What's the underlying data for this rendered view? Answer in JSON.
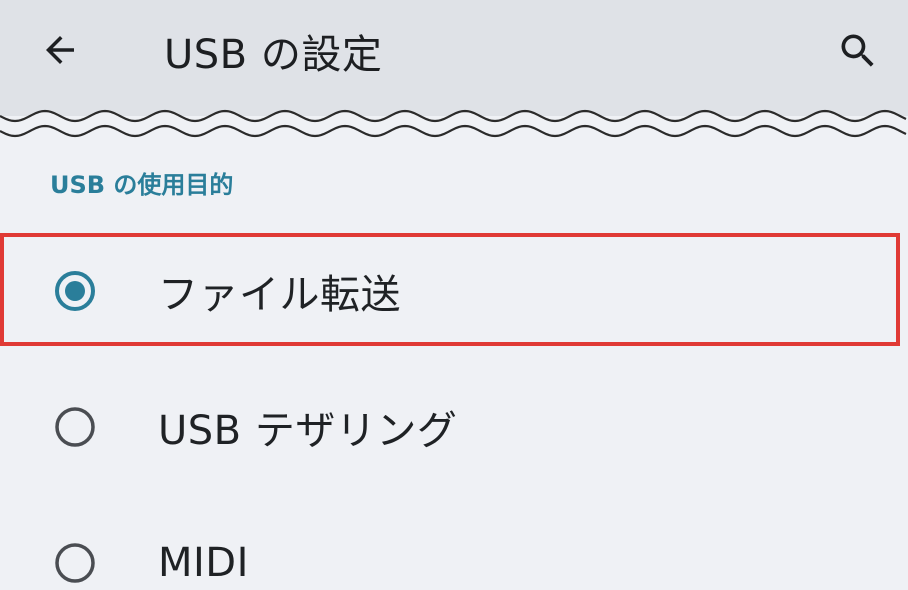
{
  "header": {
    "title": "USB の設定",
    "back_icon": "arrow-back-icon",
    "search_icon": "search-icon"
  },
  "section": {
    "title": "USB の使用目的"
  },
  "options": [
    {
      "label": "ファイル転送",
      "selected": true
    },
    {
      "label": "USB テザリング",
      "selected": false
    },
    {
      "label": "MIDI",
      "selected": false
    }
  ],
  "colors": {
    "accent": "#2a7e9a",
    "highlight": "#e03a35",
    "appbar": "#dfe2e7",
    "background": "#eff1f5"
  }
}
